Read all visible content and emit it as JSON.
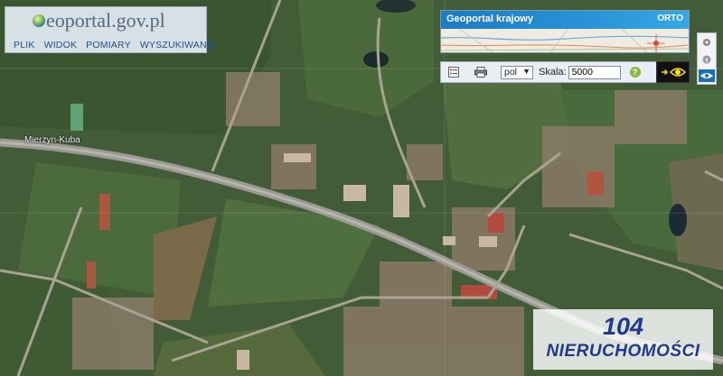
{
  "app": {
    "logo_text": "geoportal.gov.pl",
    "logo_prefix": "",
    "logo_suffix": "eoportal.gov.pl",
    "logo_g": "g"
  },
  "menu": {
    "items": [
      {
        "label": "PLIK"
      },
      {
        "label": "WIDOK"
      },
      {
        "label": "POMIARY"
      },
      {
        "label": "WYSZUKIWANIA"
      }
    ]
  },
  "overview": {
    "title": "Geoportal krajowy",
    "mode": "ORTO"
  },
  "toolbar": {
    "language": "pol",
    "scale_label": "Skala:",
    "scale_value": "5000",
    "help_label": "?"
  },
  "map": {
    "road_label": "Mierzyn-Kuba"
  },
  "watermark": {
    "number": "104",
    "text": "NIERUCHOMOŚCI"
  },
  "colors": {
    "accent": "#1b7bc4",
    "brand": "#1d3a8e",
    "help": "#8ab73e"
  }
}
